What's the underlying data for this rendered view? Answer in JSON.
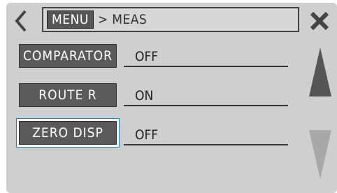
{
  "header": {
    "menu_label": "MENU",
    "separator": ">",
    "current": "MEAS"
  },
  "items": [
    {
      "label": "COMPARATOR",
      "value": "OFF",
      "selected": false
    },
    {
      "label": "ROUTE R",
      "value": "ON",
      "selected": false
    },
    {
      "label": "ZERO DISP",
      "value": "OFF",
      "selected": true
    }
  ],
  "icons": {
    "back": "chevron-left-icon",
    "close": "close-icon",
    "scroll_up": "triangle-up-icon",
    "scroll_down": "triangle-down-icon"
  },
  "colors": {
    "background": "#cfcfcf",
    "label_bg": "#5a5a5a",
    "selection": "#1c7fc2",
    "scroll_active": "#555555",
    "scroll_disabled": "#a8a8a8"
  }
}
